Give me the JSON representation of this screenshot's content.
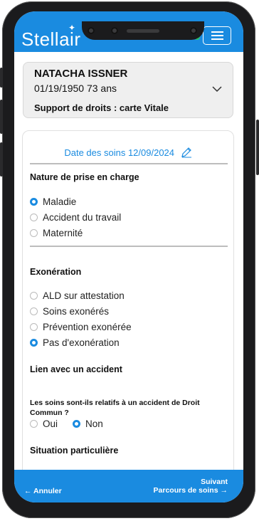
{
  "header": {
    "logo_text": "Stellair",
    "icons": [
      "info-icon",
      "shield-check-icon",
      "card-check-icon"
    ],
    "menu_icon": "hamburger-menu-icon",
    "accent_color": "#1a8be0"
  },
  "patient": {
    "name": "NATACHA ISSNER",
    "dob_age": "01/19/1950 73 ans",
    "support": "Support de droits : carte Vitale"
  },
  "form": {
    "date_label": "Date des soins 12/09/2024",
    "nature": {
      "title": "Nature de prise en charge",
      "options": [
        "Maladie",
        "Accident du travail",
        "Maternité"
      ],
      "selected": "Maladie"
    },
    "exoneration": {
      "title": "Exonération",
      "options": [
        "ALD sur attestation",
        "Soins exonérés",
        "Prévention exonérée",
        "Pas d'exonération"
      ],
      "selected": "Pas d'exonération"
    },
    "accident": {
      "title": "Lien avec un accident",
      "question": "Les soins sont-ils relatifs à un accident de Droit Commun ?",
      "options": [
        "Oui",
        "Non"
      ],
      "selected": "Non"
    },
    "situation_title": "Situation particulière"
  },
  "footer": {
    "cancel_label": "Annuler",
    "next_label": "Suivant",
    "next_sub_label": "Parcours de soins"
  }
}
